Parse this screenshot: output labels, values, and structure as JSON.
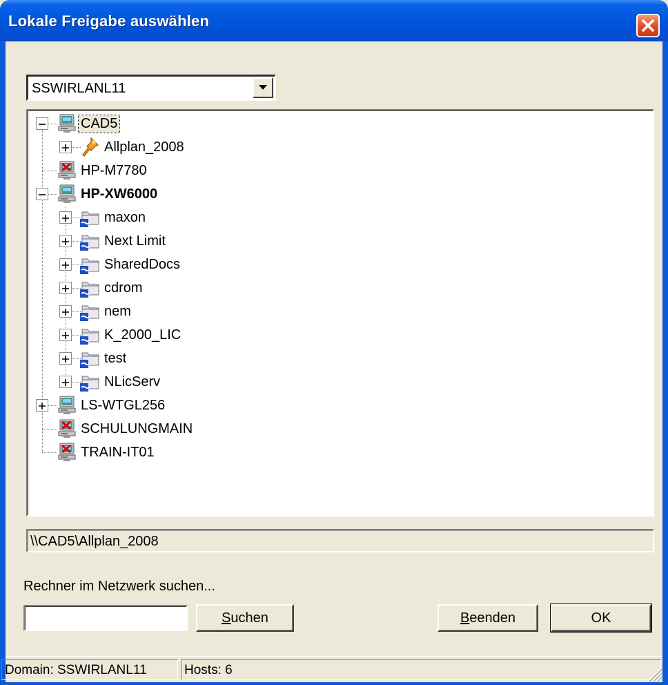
{
  "window": {
    "title": "Lokale Freigabe auswählen"
  },
  "domain_select": {
    "value": "SSWIRLANL11"
  },
  "tree": {
    "nodes": [
      {
        "label": "CAD5",
        "type": "computer",
        "status": "online",
        "expanded": true,
        "selected": true
      },
      {
        "label": "Allplan_2008",
        "type": "share-pinned",
        "expanded": false
      },
      {
        "label": "HP-M7780",
        "type": "computer",
        "status": "offline"
      },
      {
        "label": "HP-XW6000",
        "type": "computer",
        "status": "online",
        "expanded": true,
        "bold": true
      },
      {
        "label": "maxon",
        "type": "share"
      },
      {
        "label": "Next Limit",
        "type": "share"
      },
      {
        "label": "SharedDocs",
        "type": "share"
      },
      {
        "label": "cdrom",
        "type": "share"
      },
      {
        "label": "nem",
        "type": "share"
      },
      {
        "label": "K_2000_LIC",
        "type": "share"
      },
      {
        "label": "test",
        "type": "share"
      },
      {
        "label": "NLicServ",
        "type": "share"
      },
      {
        "label": "LS-WTGL256",
        "type": "computer",
        "status": "online",
        "expanded": false
      },
      {
        "label": "SCHULUNGMAIN",
        "type": "computer",
        "status": "offline"
      },
      {
        "label": "TRAIN-IT01",
        "type": "computer",
        "status": "offline"
      }
    ]
  },
  "path": {
    "value": "\\\\CAD5\\Allplan_2008"
  },
  "search": {
    "label": "Rechner im Netzwerk suchen...",
    "value": "",
    "button_label_first": "S",
    "button_label_rest": "uchen"
  },
  "buttons": {
    "quit_first": "B",
    "quit_rest": "eenden",
    "ok_label": "OK"
  },
  "statusbar": {
    "domain": "Domain: SSWIRLANL11",
    "hosts": "Hosts: 6"
  },
  "colors": {
    "titlebar": "#0058e0",
    "close": "#e2502a",
    "dialog_bg": "#ece9d8"
  }
}
